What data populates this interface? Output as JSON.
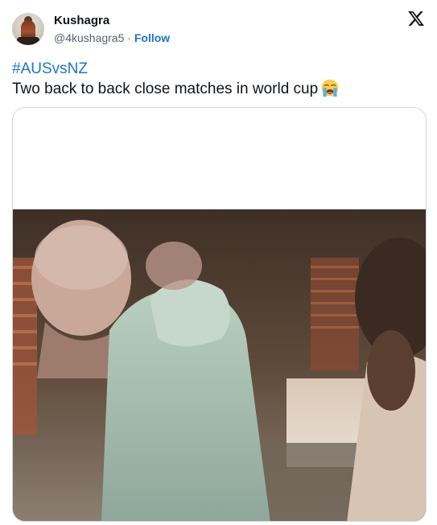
{
  "tweet": {
    "author_name": "Kushagra",
    "author_handle": "@4kushagra5",
    "separator": "·",
    "follow_label": "Follow",
    "hashtag": "#AUSvsNZ",
    "text": "Two back to back close matches in world cup",
    "emoji_icon": "loudly-crying-face-icon",
    "link_color": "#1d74c8"
  },
  "media": {
    "type": "video",
    "thumbnail_icon": "video-thumbnail"
  }
}
